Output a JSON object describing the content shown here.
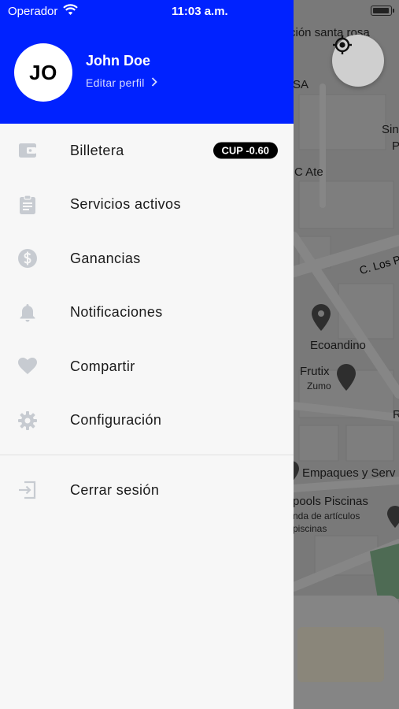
{
  "status_bar": {
    "carrier": "Operador",
    "time": "11:03 a.m."
  },
  "profile": {
    "initials": "JO",
    "name": "John Doe",
    "edit_label": "Editar perfil"
  },
  "menu": {
    "items": [
      {
        "label": "Billetera",
        "icon": "wallet-icon",
        "badge": "CUP -0.60"
      },
      {
        "label": "Servicios activos",
        "icon": "clipboard-icon"
      },
      {
        "label": "Ganancias",
        "icon": "dollar-circle-icon"
      },
      {
        "label": "Notificaciones",
        "icon": "bell-icon"
      },
      {
        "label": "Compartir",
        "icon": "heart-icon"
      },
      {
        "label": "Configuración",
        "icon": "gear-icon"
      }
    ],
    "logout": {
      "label": "Cerrar sesión",
      "icon": "logout-icon"
    }
  },
  "map": {
    "labels": [
      "ción santa rosa",
      "SA",
      "Sin",
      "P",
      "C Ate",
      "C. Los P",
      "Ecoandino",
      "Frutix",
      "Zumo",
      "R",
      "Empaques y Serv",
      "pools Piscinas",
      "nda de artículos",
      "piscinas"
    ]
  },
  "colors": {
    "header_bg": "#0022ff",
    "drawer_bg": "#f7f7f7",
    "icon_gray": "#c7cbd1",
    "badge_bg": "#000000"
  }
}
